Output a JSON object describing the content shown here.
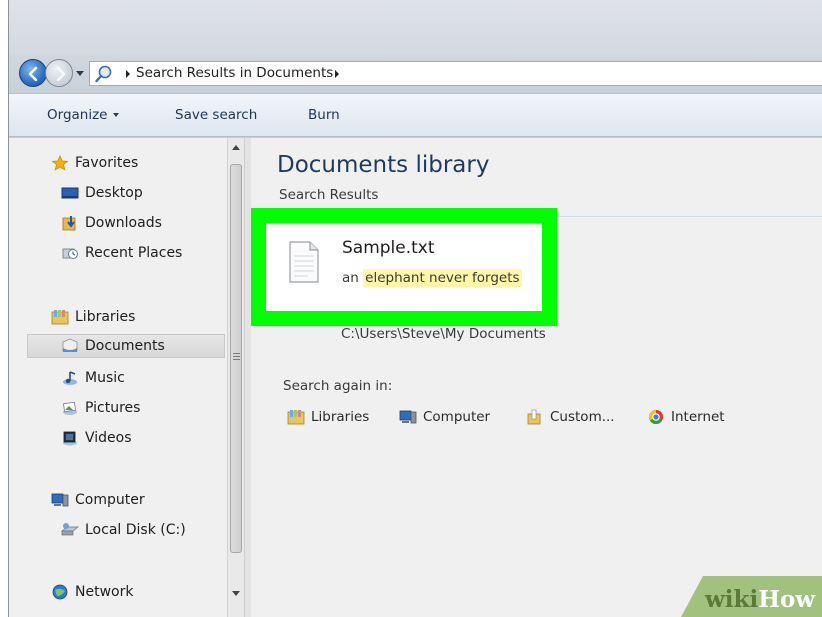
{
  "address": {
    "location": "Search Results in Documents"
  },
  "toolbar": {
    "organize": "Organize",
    "save_search": "Save search",
    "burn": "Burn"
  },
  "navpane": {
    "favorites": "Favorites",
    "desktop": "Desktop",
    "downloads": "Downloads",
    "recent_places": "Recent Places",
    "libraries": "Libraries",
    "documents": "Documents",
    "music": "Music",
    "pictures": "Pictures",
    "videos": "Videos",
    "computer": "Computer",
    "local_disk": "Local Disk (C:)",
    "network": "Network"
  },
  "main": {
    "title": "Documents library",
    "subtitle": "Search Results",
    "result": {
      "name": "Sample.txt",
      "snippet_prefix": "an",
      "snippet_match": "elephant never forgets",
      "path": "C:\\Users\\Steve\\My Documents"
    },
    "search_again": {
      "label": "Search again in:",
      "libraries": "Libraries",
      "computer": "Computer",
      "custom": "Custom...",
      "internet": "Internet"
    }
  },
  "watermark": {
    "wiki": "wiki",
    "how": "How"
  },
  "colors": {
    "highlight_border": "#00ff00",
    "match_highlight": "#fff6a8",
    "title_blue": "#1e3a5f"
  }
}
